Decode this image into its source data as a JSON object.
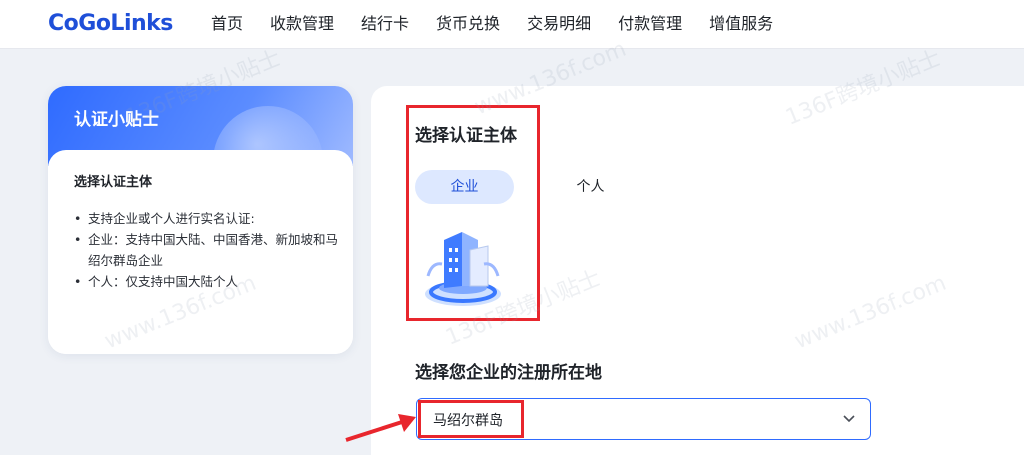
{
  "header": {
    "logo_text": "CoGoLinks",
    "nav": [
      "首页",
      "收款管理",
      "结行卡",
      "货币兑换",
      "交易明细",
      "付款管理",
      "增值服务"
    ]
  },
  "tips": {
    "title": "认证小贴士",
    "subtitle": "选择认证主体",
    "items": [
      "支持企业或个人进行实名认证:",
      "企业：支持中国大陆、中国香港、新加坡和马绍尔群岛企业",
      "个人：仅支持中国大陆个人"
    ]
  },
  "main": {
    "entity_title": "选择认证主体",
    "entity_options": [
      "企业",
      "个人"
    ],
    "selected_entity": "企业",
    "location_title": "选择您企业的注册所在地",
    "location_value": "马绍尔群岛"
  },
  "watermarks": [
    "136F跨境小贴士",
    "www.136f.com"
  ],
  "colors": {
    "brand_blue": "#1f4fd8",
    "accent_blue": "#2f6bff",
    "highlight_red": "#e8262d",
    "segment_active_bg": "#dde8ff",
    "page_bg": "#eef1f6"
  },
  "icons": [
    "chevron-down-icon",
    "arrow-pointer-icon",
    "building-illustration"
  ]
}
